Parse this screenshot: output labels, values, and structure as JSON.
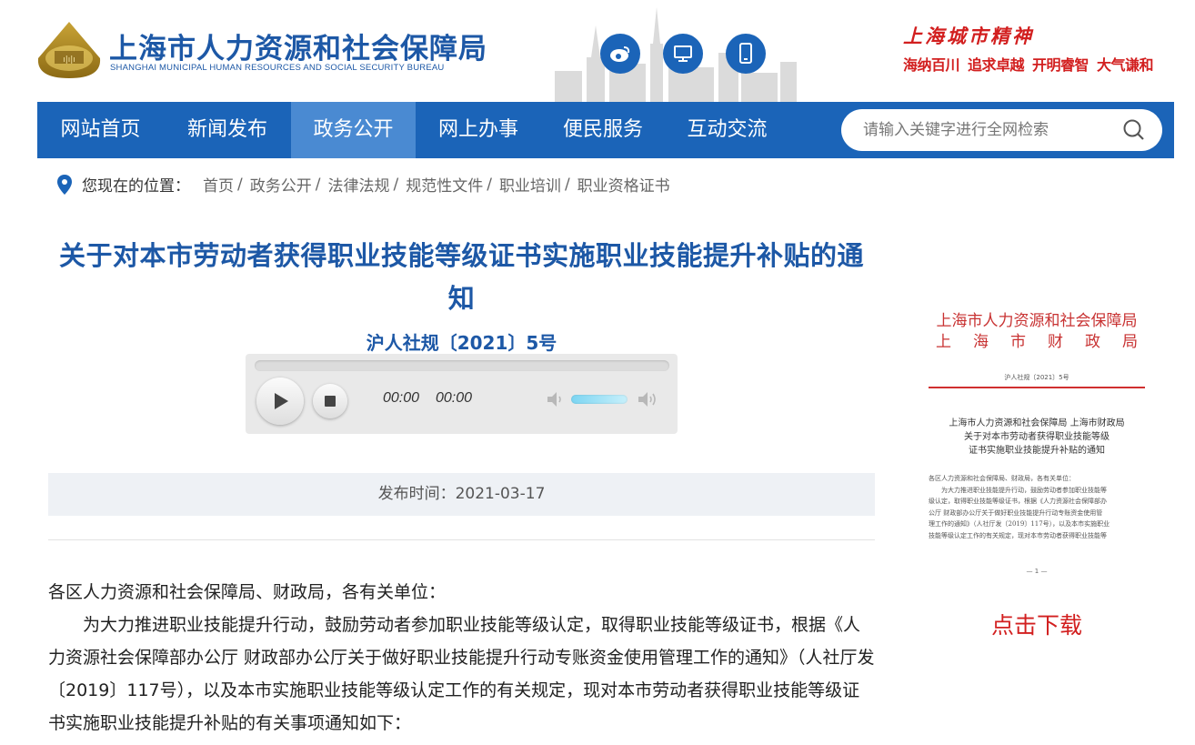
{
  "header": {
    "title": "上海市人力资源和社会保障局",
    "subtitle": "SHANGHAI MUNICIPAL HUMAN RESOURCES AND SOCIAL SECURITY BUREAU",
    "quick_icons": [
      "weibo-icon",
      "desktop-icon",
      "mobile-icon"
    ],
    "motto_title": "上海城市精神",
    "motto_items": [
      "海纳百川",
      "追求卓越",
      "开明睿智",
      "大气谦和"
    ]
  },
  "nav": {
    "items": [
      "网站首页",
      "新闻发布",
      "政务公开",
      "网上办事",
      "便民服务",
      "互动交流"
    ],
    "active_index": 2,
    "search_placeholder": "请输入关键字进行全网检索"
  },
  "breadcrumb": {
    "label": "您现在的位置：",
    "items": [
      "首页",
      "政务公开",
      "法律法规",
      "规范性文件",
      "职业培训",
      "职业资格证书"
    ]
  },
  "article": {
    "title": "关于对本市劳动者获得职业技能等级证书实施职业技能提升补贴的通知",
    "doc_number": "沪人社规〔2021〕5号",
    "player": {
      "current_time": "00:00",
      "duration": "00:00",
      "volume": 0.8,
      "progress": 0
    },
    "pubdate": "发布时间：2021-03-17",
    "salutation": "各区人力资源和社会保障局、财政局，各有关单位：",
    "paragraph": "为大力推进职业技能提升行动，鼓励劳动者参加职业技能等级认定，取得职业技能等级证书，根据《人力资源社会保障部办公厅 财政部办公厅关于做好职业技能提升行动专账资金使用管理工作的通知》（人社厅发〔2019〕117号），以及本市实施职业技能等级认定工作的有关规定，现对本市劳动者获得职业技能等级证书实施职业技能提升补贴的有关事项通知如下："
  },
  "sidebar": {
    "doc_preview": {
      "head_line1": "上海市人力资源和社会保障局",
      "head_line2": [
        "上",
        "海",
        "市",
        "财",
        "政",
        "局"
      ],
      "doc_number": "沪人社规〔2021〕5号",
      "subtitle_lines": [
        "上海市人力资源和社会保障局 上海市财政局",
        "关于对本市劳动者获得职业技能等级",
        "证书实施职业技能提升补贴的通知"
      ],
      "body_lines": [
        "各区人力资源和社会保障局、财政局，各有关单位：",
        "　　为大力推进职业技能提升行动，鼓励劳动者参加职业技能等",
        "级认定，取得职业技能等级证书，根据《人力资源社会保障部办",
        "公厅 财政部办公厅关于做好职业技能提升行动专账资金使用管",
        "理工作的通知》（人社厅发〔2019〕117号），以及本市实施职业",
        "技能等级认定工作的有关规定，现对本市劳动者获得职业技能等"
      ],
      "page_number": "— 1 —"
    },
    "download_label": "点击下载"
  },
  "colors": {
    "brand_blue": "#1b64b8",
    "active_nav": "#4a8ad2",
    "title_blue": "#1d58a6",
    "motto_red": "#d21f1f"
  }
}
